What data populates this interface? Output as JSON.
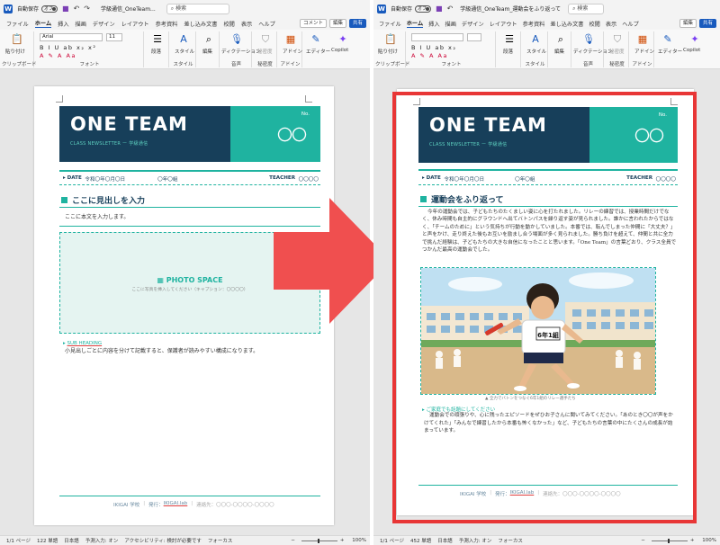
{
  "left_window": {
    "autosave_label": "自動保存",
    "autosave_state": "オフ",
    "doc_title": "学級通信_OneTeam...",
    "search_placeholder": "検索",
    "menu": [
      "ファイル",
      "ホーム",
      "挿入",
      "描画",
      "デザイン",
      "レイアウト",
      "参考資料",
      "差し込み文書",
      "校閲",
      "表示",
      "ヘルプ"
    ],
    "active_menu": "ホーム",
    "comment_button": "コメント",
    "edit_button": "編集",
    "share_button": "共有",
    "ribbon": {
      "paste": "貼り付け",
      "clipboard": "クリップボード",
      "font_name": "Arial",
      "font_size": "11",
      "font_group": "フォント",
      "paragraph": "段落",
      "styles": "スタイル",
      "editing": "編集",
      "dictation": "ディクテーション",
      "sensitivity": "秘密度",
      "addins": "アドイン",
      "editor": "エディター",
      "copilot": "Copilot",
      "voice_group": "音声",
      "sensitivity_group": "秘密度",
      "addin_group": "アドイン"
    },
    "status": {
      "page": "1/1 ページ",
      "words": "122 単語",
      "lang": "日本語",
      "predict": "予測入力: オン",
      "accessibility": "アクセシビリティ: 検討が必要です",
      "focus": "フォーカス",
      "zoom": "100%"
    },
    "doc": {
      "title": "ONE TEAM",
      "subtitle": "CLASS NEWSLETTER ー 学級通信",
      "no_label": "No.",
      "no_value": "〇〇",
      "date_label": "DATE",
      "date_value": "令和〇年〇月〇日",
      "class_value": "〇年〇組",
      "teacher_label": "TEACHER",
      "teacher_value": "〇〇〇〇",
      "heading": "ここに見出しを入力",
      "body": "ここに本文を入力します。",
      "photo_label": "PHOTO SPACE",
      "photo_caption": "ここに写真を挿入してください（キャプション：〇〇〇〇）",
      "subheading": "SUB HEADING",
      "sub_body": "小見出しごとに内容を分けて記載すると、保護者が読みやすい構成になります。",
      "footer_school": "IKIGAI 学校",
      "footer_publisher_label": "発行：",
      "footer_publisher": "IKIGAI.lab",
      "footer_contact": "連絡先：〇〇〇-〇〇〇〇-〇〇〇〇"
    }
  },
  "right_window": {
    "autosave_label": "自動保存",
    "autosave_state": "オフ",
    "doc_title": "学級通信_OneTeam_運動会をふり返って",
    "search_placeholder": "検索",
    "menu": [
      "ファイル",
      "ホーム",
      "挿入",
      "描画",
      "デザイン",
      "レイアウト",
      "参考資料",
      "差し込み文書",
      "校閲",
      "表示",
      "ヘルプ"
    ],
    "active_menu": "ホーム",
    "edit_button": "編集",
    "share_button": "共有",
    "ribbon": {
      "paste": "貼り付け",
      "clipboard": "クリップボード",
      "font_group": "フォント",
      "paragraph": "段落",
      "styles": "スタイル",
      "editing": "編集",
      "dictation": "ディクテーション",
      "sensitivity": "秘密度",
      "addins": "アドイン",
      "editor": "エディター",
      "copilot": "Copilot",
      "voice_group": "音声",
      "sensitivity_group": "秘密度",
      "addin_group": "アドイン"
    },
    "status": {
      "page": "1/1 ページ",
      "words": "452 単語",
      "lang": "日本語",
      "predict": "予測入力: オン",
      "focus": "フォーカス",
      "zoom": "100%"
    },
    "doc": {
      "title": "ONE TEAM",
      "subtitle": "CLASS NEWSLETTER ー 学級通信",
      "no_label": "No.",
      "no_value": "〇〇",
      "date_label": "DATE",
      "date_value": "令和〇年〇月〇日",
      "class_value": "〇年〇組",
      "teacher_label": "TEACHER",
      "teacher_value": "〇〇〇〇",
      "heading": "運動会をふり返って",
      "body": "今年の運動会では、子どもたちのたくましい姿に心を打たれました。リレーの練習では、授業時間だけでなく、休み時間も自主的にグラウンドへ出てバトンパスを繰り返す姿が見られました。誰かに言われたからではなく、「チームのために」という気持ちが行動を動かしていました。本番では、転んでしまった仲間に「大丈夫？」と声をかけ、走り終えた後もお互いを励まし合う場面が多く見られました。勝ち負けを超えて、仲間と共に全力で挑んだ経験は、子どもたちの大きな自信になったことと思います。「One Team」の言葉どおり、クラス全員でつかんだ最高の運動会でした。",
      "illustration_bib": "6年1組",
      "illustration_caption": "全力でバトンをつなぐ6年1組のリレー選手たち",
      "subheading": "ご家庭でも話題にしてください",
      "sub_body": "運動会での頑張りや、心に残ったエピソードをぜひお子さんに聞いてみてください。「あのとき〇〇が声をかけてくれた」「みんなで練習したから本番も怖くなかった」など、子どもたちの言葉の中にたくさんの成長が詰まっています。",
      "footer_school": "IKIGAI 学校",
      "footer_publisher_label": "発行：",
      "footer_publisher": "IKIGAI.lab",
      "footer_contact": "連絡先：〇〇〇-〇〇〇〇-〇〇〇〇"
    }
  },
  "colors": {
    "navy": "#173f5a",
    "teal": "#1fb3a0",
    "red": "#e83636",
    "word_blue": "#185abd"
  }
}
